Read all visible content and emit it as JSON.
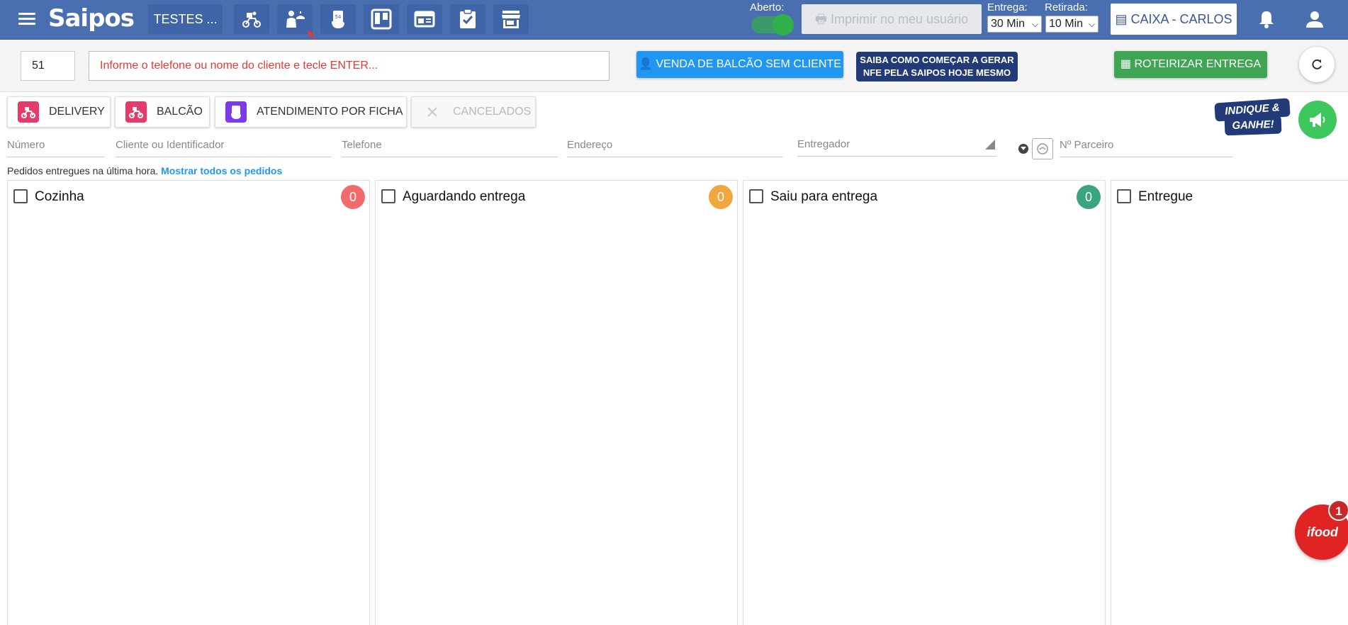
{
  "header": {
    "logo": "Saipos",
    "store": "TESTES ...",
    "aberto_label": "Aberto:",
    "print_label": "Imprimir no meu usuário",
    "entrega_label": "Entrega:",
    "entrega_value": "30 Min",
    "retirada_label": "Retirada:",
    "retirada_value": "10 Min",
    "caixa_label": "CAIXA - CARLOS",
    "colors": {
      "bar": "#4a6fb0",
      "toggle_on": "#2fb04a"
    }
  },
  "toolbar": {
    "order_number": "51",
    "phone_placeholder": "Informe o telefone ou nome do cliente e tecle ENTER...",
    "venda_label": "VENDA DE BALCÃO SEM CLIENTE",
    "nfe_line1": "SAIBA COMO COMEÇAR A GERAR",
    "nfe_line2": "NFE PELA SAIPOS HOJE MESMO",
    "roteirizar_label": "ROTEIRIZAR ENTREGA"
  },
  "tabs": [
    {
      "label": "DELIVERY"
    },
    {
      "label": "BALCÃO"
    },
    {
      "label": "ATENDIMENTO POR FICHA"
    },
    {
      "label": "CANCELADOS"
    }
  ],
  "promo": {
    "line1": "INDIQUE &",
    "line2": "GANHE!"
  },
  "filters": {
    "numero": "Número",
    "cliente": "Cliente ou Identificador",
    "telefone": "Telefone",
    "endereco": "Endereço",
    "entregador": "Entregador",
    "parceiro": "Nº Parceiro"
  },
  "info": {
    "text": "Pedidos entregues na última hora.",
    "link": "Mostrar todos os pedidos"
  },
  "columns": [
    {
      "title": "Cozinha",
      "count": "0",
      "color": "#f26b6b"
    },
    {
      "title": "Aguardando entrega",
      "count": "0",
      "color": "#f0a73e"
    },
    {
      "title": "Saiu para entrega",
      "count": "0",
      "color": "#3aa47f"
    },
    {
      "title": "Entregue"
    }
  ],
  "chat": {
    "label": "ifood",
    "badge": "1"
  }
}
